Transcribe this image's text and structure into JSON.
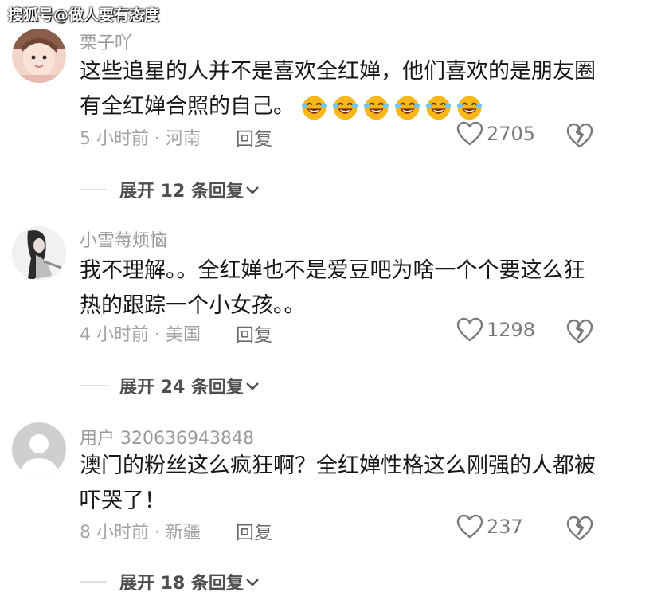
{
  "watermark": "搜狐号@做人要有态度",
  "comments": [
    {
      "username": "栗子吖",
      "content": "这些追星的人并不是喜欢全红婵，他们喜欢的是朋友圈有全红婵合照的自己。",
      "emoji_count": 6,
      "emoji_icon": "laughing-crying-emoji-icon",
      "time_location": "5 小时前 · 河南",
      "reply_label": "回复",
      "likes": "2705",
      "expand_label": "展开 12 条回复"
    },
    {
      "username": "小雪莓烦恼",
      "content": "我不理解。。全红婵也不是爱豆吧为啥一个个要这么狂热的跟踪一个小女孩。。",
      "time_location": "4 小时前 · 美国",
      "reply_label": "回复",
      "likes": "1298",
      "expand_label": "展开 24 条回复"
    },
    {
      "username": "用户 320636943848",
      "content": "澳门的粉丝这么疯狂啊？全红婵性格这么刚强的人都被吓哭了！",
      "time_location": "8 小时前 · 新疆",
      "reply_label": "回复",
      "likes": "237",
      "expand_label": "展开 18 条回复"
    }
  ],
  "icons": {
    "like": "heart-icon",
    "dislike": "broken-heart-icon",
    "expand": "chevron-down-icon",
    "default_avatar": "default-avatar-icon"
  },
  "colors": {
    "text": "#161616",
    "muted": "#9a9a9a",
    "background": "#ffffff"
  }
}
